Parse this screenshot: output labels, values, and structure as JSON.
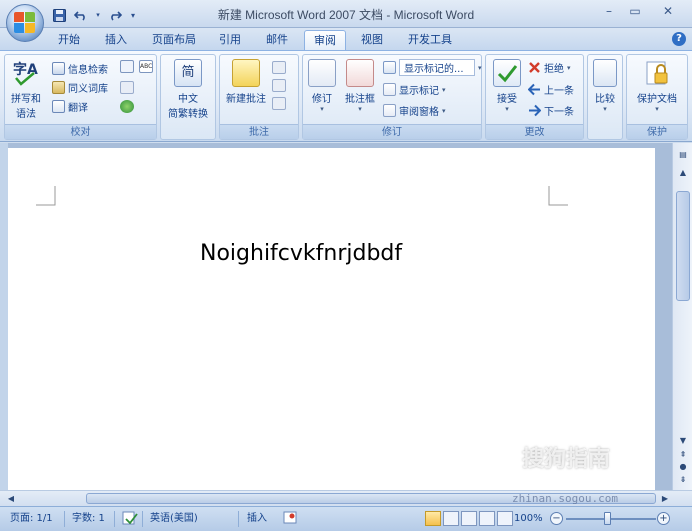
{
  "window": {
    "title": "新建 Microsoft Word 2007 文档 - Microsoft Word"
  },
  "qat": {
    "save_icon": "save-icon",
    "undo_icon": "undo-icon",
    "redo_icon": "redo-icon"
  },
  "tabs": [
    {
      "label": "开始"
    },
    {
      "label": "插入"
    },
    {
      "label": "页面布局"
    },
    {
      "label": "引用"
    },
    {
      "label": "邮件"
    },
    {
      "label": "审阅",
      "active": true
    },
    {
      "label": "视图"
    },
    {
      "label": "开发工具"
    }
  ],
  "ribbon": {
    "proofing": {
      "group_label": "校对",
      "spelling_label": "拼写和\n语法",
      "spelling_line1": "拼写和",
      "spelling_line2": "语法",
      "research": "信息检索",
      "thesaurus": "同义词库",
      "translate": "翻译"
    },
    "chinese": {
      "button_line1": "中文",
      "button_line2": "简繁转换",
      "icon_char": "简"
    },
    "comments": {
      "group_label": "批注",
      "new_comment": "新建批注"
    },
    "tracking": {
      "group_label": "修订",
      "track_changes": "修订",
      "balloons": "批注框",
      "display_dropdown": "显示标记的...",
      "show_markup": "显示标记",
      "reviewing_pane": "审阅窗格"
    },
    "changes": {
      "group_label": "更改",
      "accept": "接受",
      "reject": "拒绝",
      "previous": "上一条",
      "next": "下一条"
    },
    "compare": {
      "label": "比较"
    },
    "protect": {
      "group_label": "保护",
      "protect_document": "保护文档"
    }
  },
  "document": {
    "text": "Noighifcvkfnrjdbdf"
  },
  "status": {
    "page": "页面: 1/1",
    "words": "字数: 1",
    "language": "英语(美国)",
    "insert_mode": "插入",
    "zoom": "100%"
  },
  "watermark": {
    "brand": "搜狗指南",
    "url": "zhinan.sogou.com"
  },
  "colors": {
    "accent": "#15428b",
    "ribbon_bg": "#dfe9f6",
    "page_bg": "#ffffff"
  }
}
